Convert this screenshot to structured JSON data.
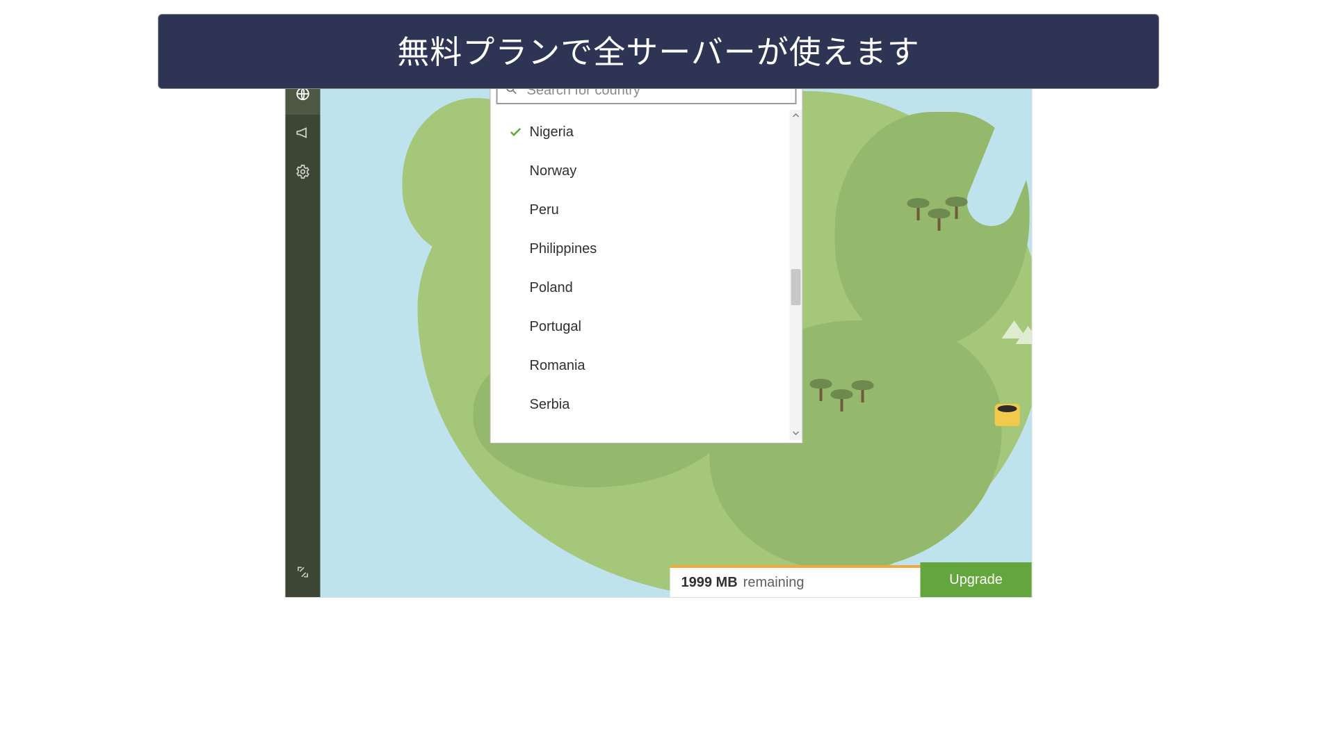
{
  "banner": {
    "text": "無料プランで全サーバーが使えます"
  },
  "sidebar": {
    "items": [
      {
        "name": "globe-icon",
        "active": true
      },
      {
        "name": "announce-icon",
        "active": false
      },
      {
        "name": "gear-icon",
        "active": false
      }
    ],
    "collapse": {
      "name": "collapse-icon"
    }
  },
  "search": {
    "placeholder": "Search for country",
    "value": ""
  },
  "countries": [
    {
      "label": "Nigeria",
      "selected": true
    },
    {
      "label": "Norway",
      "selected": false
    },
    {
      "label": "Peru",
      "selected": false
    },
    {
      "label": "Philippines",
      "selected": false
    },
    {
      "label": "Poland",
      "selected": false
    },
    {
      "label": "Portugal",
      "selected": false
    },
    {
      "label": "Romania",
      "selected": false
    },
    {
      "label": "Serbia",
      "selected": false
    }
  ],
  "status": {
    "amount": "1999 MB",
    "remaining_label": "remaining",
    "upgrade_label": "Upgrade"
  },
  "colors": {
    "banner_bg": "#2e3454",
    "sidebar_bg": "#3d4635",
    "accent_green": "#63a63e",
    "accent_orange": "#f2a93b",
    "land": "#a5c77a",
    "water": "#bfe3ec"
  }
}
